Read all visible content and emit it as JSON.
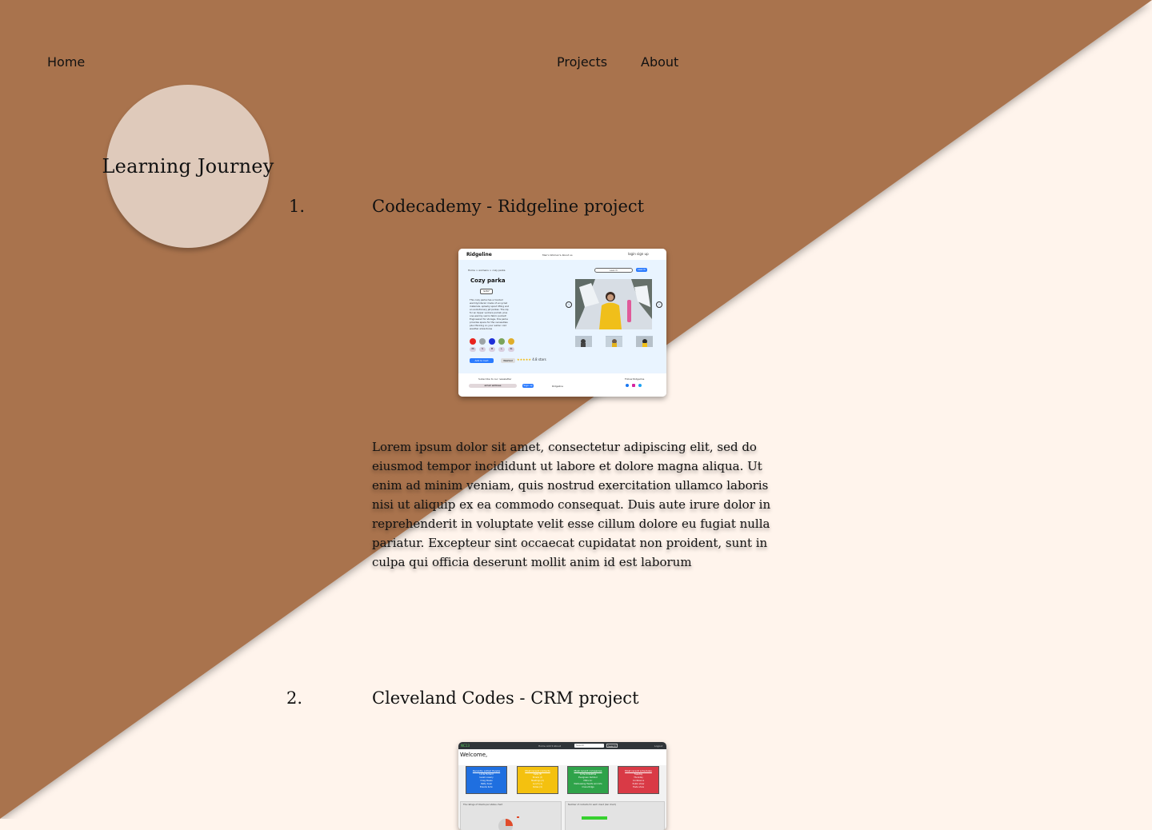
{
  "nav": {
    "home": "Home",
    "projects": "Projects",
    "about": "About"
  },
  "hero": {
    "title": "Learning Journey"
  },
  "colors": {
    "brown": "#a9734e",
    "cream": "#fff4ec",
    "circle": "#dfcabb"
  },
  "projects": [
    {
      "number": "1.",
      "title": "Codecademy - Ridgeline project",
      "description": "Lorem ipsum dolor sit amet, consectetur adipiscing elit, sed do eiusmod tempor incididunt ut labore et dolore magna aliqua. Ut enim ad minim veniam, quis nostrud exercitation ullamco laboris nisi ut aliquip ex ea commodo consequat. Duis aute irure dolor in reprehenderit in voluptate velit esse cillum dolore eu fugiat nulla pariatur. Excepteur sint occaecat cupidatat non proident, sunt in culpa qui officia deserunt mollit anim id est laborum",
      "screenshot": {
        "logo": "Ridgeline",
        "nav": "Men's   Women's   About us",
        "icons": "login   sign up",
        "breadcrumb": "Home  >  womens  >  cozy parka",
        "search_placeholder": "search",
        "search_button": "search",
        "product_name": "Cozy parka",
        "price": "$157",
        "product_text": "This cozy parka has a hooded warmly/interior made of uncycled materials, splashy spout lifting and an evolutionary jet parkas. The zip for an Upper venture pocket, plus one warmly velcro fabric pocket! Engineered for storage, this parka provides space for the necessities plus thinking on your winter cold weather adventures",
        "color_swatches": [
          "#e8231e",
          "#9ca3a6",
          "#1d2fd8",
          "#7aa35a",
          "#e0ad2a"
        ],
        "sizes": [
          "XS",
          "S",
          "M",
          "L",
          "XL"
        ],
        "add_to_cart": "Add to Cart",
        "wishlist": "Wishlist",
        "rating_text": "4.8 stars",
        "newsletter_label": "Subscribe to our newsletter",
        "email_placeholder": "email address",
        "sign_up": "Sign up",
        "footer_logo": "Ridgeline",
        "follow_label": "Follow Ridgeline"
      }
    },
    {
      "number": "2.",
      "title": "Cleveland Codes - CRM project",
      "screenshot": {
        "brand": "NC13",
        "nav": "Home   Add ▾   About",
        "search_placeholder": "Search",
        "search_button": "Search",
        "logout": "Logout",
        "welcome": "Welcome,",
        "cards": [
          {
            "title": "Recently added People",
            "lines": [
              "Linda Ferrand",
              "Isaiah Lowery",
              "Craig Steele",
              "Betty Snell",
              "Brenda Kuhn"
            ],
            "color": "#1f6fe0"
          },
          {
            "title": "Most recent contacts",
            "lines": [
              "Calls (3)",
              "Emails (7)",
              "Meetings (2)",
              "Lunch (1)",
              "Notes (4)"
            ],
            "color": "#f4c10f"
          },
          {
            "title": "Most recent companies",
            "lines": [
              "Acme Industries",
              "Evergreen Outdoor",
              "Mitra Inc",
              "Wellnessing Hearts and Arts",
              "Crane Ridge"
            ],
            "color": "#2fa34a"
          },
          {
            "title": "Most recent schedules",
            "lines": [
              "Tuesday",
              "Thursday",
              "Conference",
              "Public show",
              "Trade show"
            ],
            "color": "#d93a46"
          }
        ],
        "panel_left": "The ratings of Clients per status chart",
        "panel_right": "Number of contacts for each client (bar chart)"
      }
    }
  ]
}
